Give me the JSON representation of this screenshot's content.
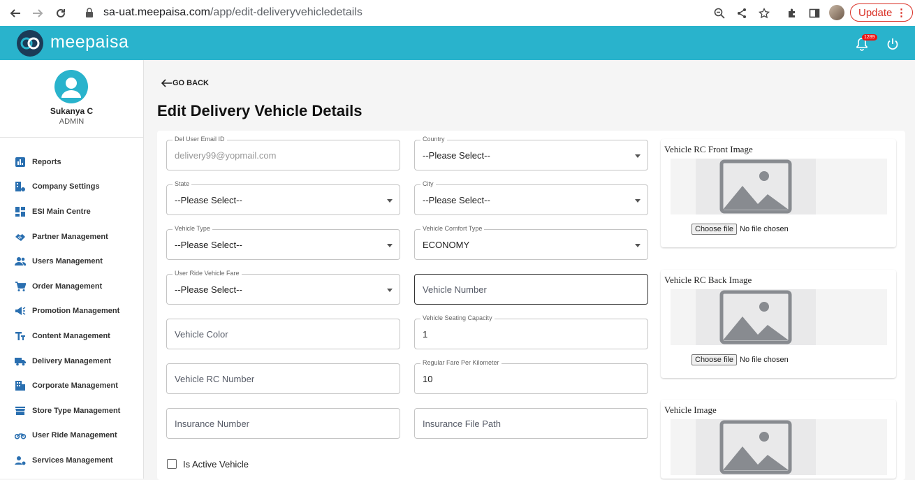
{
  "browser": {
    "url_host": "sa-uat.meepaisa.com",
    "url_path": "/app/edit-deliveryvehicledetails",
    "update_label": "Update"
  },
  "header": {
    "brand": "meepaisa",
    "notification_count": "1289"
  },
  "user": {
    "name": "Sukanya C",
    "role": "ADMIN"
  },
  "sidebar": {
    "items": [
      {
        "label": "Reports",
        "icon": "bar-chart-icon"
      },
      {
        "label": "Company Settings",
        "icon": "company-settings-icon"
      },
      {
        "label": "ESI Main Centre",
        "icon": "dashboard-icon"
      },
      {
        "label": "Partner Management",
        "icon": "handshake-icon"
      },
      {
        "label": "Users Management",
        "icon": "users-icon"
      },
      {
        "label": "Order Management",
        "icon": "cart-icon"
      },
      {
        "label": "Promotion Management",
        "icon": "megaphone-icon"
      },
      {
        "label": "Content Management",
        "icon": "text-fields-icon"
      },
      {
        "label": "Delivery Management",
        "icon": "truck-icon"
      },
      {
        "label": "Corporate Management",
        "icon": "building-icon"
      },
      {
        "label": "Store Type Management",
        "icon": "store-icon"
      },
      {
        "label": "User Ride Management",
        "icon": "motorcycle-icon"
      },
      {
        "label": "Services Management",
        "icon": "services-icon"
      }
    ]
  },
  "main": {
    "go_back": "GO BACK",
    "title": "Edit Delivery Vehicle Details"
  },
  "form": {
    "email": {
      "label": "Del User Email ID",
      "value": "delivery99@yopmail.com"
    },
    "country": {
      "label": "Country",
      "value": "--Please Select--"
    },
    "state": {
      "label": "State",
      "value": "--Please Select--"
    },
    "city": {
      "label": "City",
      "value": "--Please Select--"
    },
    "vehicle_type": {
      "label": "Vehicle Type",
      "value": "--Please Select--"
    },
    "comfort_type": {
      "label": "Vehicle Comfort Type",
      "value": "ECONOMY"
    },
    "ride_fare": {
      "label": "User Ride Vehicle Fare",
      "value": "--Please Select--"
    },
    "vehicle_number": {
      "placeholder": "Vehicle Number"
    },
    "vehicle_color": {
      "placeholder": "Vehicle Color"
    },
    "seating": {
      "label": "Vehicle Seating Capacity",
      "value": "1"
    },
    "rc_number": {
      "placeholder": "Vehicle RC Number"
    },
    "fare_per_km": {
      "label": "Regular Fare Per Kilometer",
      "value": "10"
    },
    "insurance_number": {
      "placeholder": "Insurance Number"
    },
    "insurance_path": {
      "placeholder": "Insurance File Path"
    },
    "is_active_label": "Is Active Vehicle"
  },
  "images": {
    "rc_front": {
      "title": "Vehicle RC Front Image",
      "button": "Choose file",
      "status": "No file chosen"
    },
    "rc_back": {
      "title": "Vehicle RC Back Image",
      "button": "Choose file",
      "status": "No file chosen"
    },
    "vehicle": {
      "title": "Vehicle Image"
    }
  }
}
